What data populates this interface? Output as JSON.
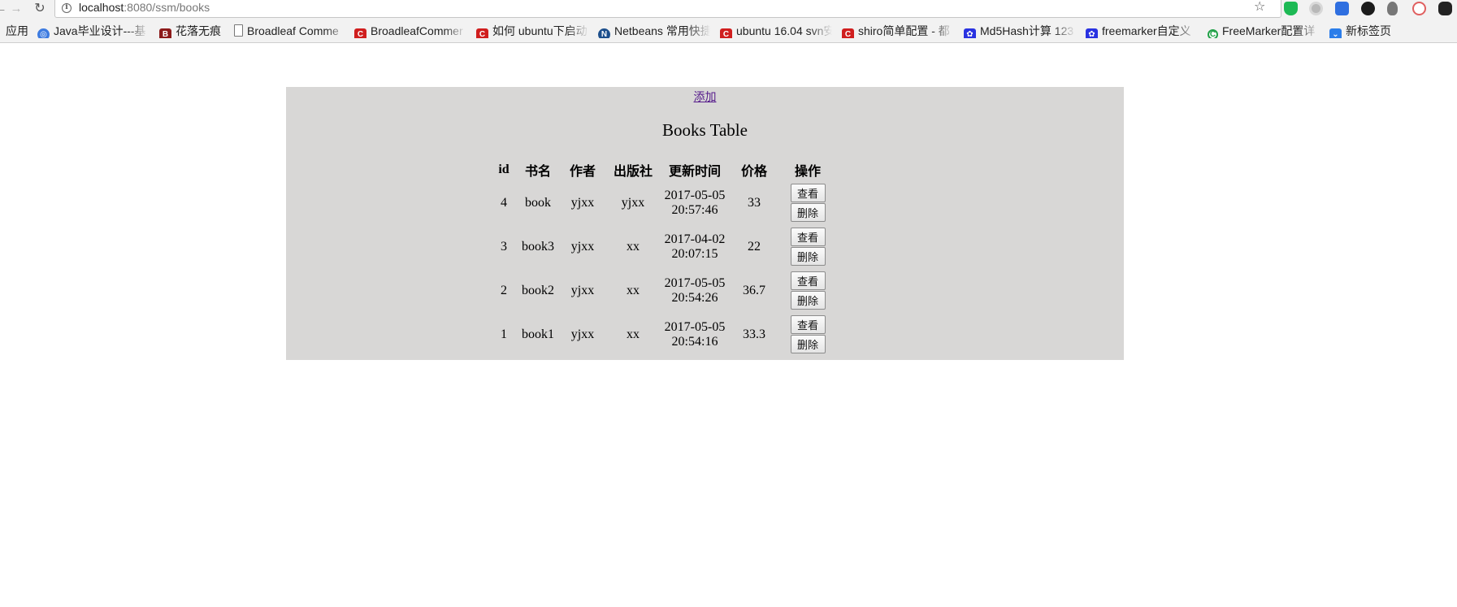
{
  "browser": {
    "url_host": "localhost",
    "url_rest": ":8080/ssm/books",
    "apps_label": "应用",
    "bookmarks": [
      {
        "label": "Java毕业设计---基",
        "icon": "globe-icon"
      },
      {
        "label": "花落无痕",
        "icon": "b-logo-icon"
      },
      {
        "label": "Broadleaf Comme",
        "icon": "page-icon"
      },
      {
        "label": "BroadleafCommer",
        "icon": "csdn-icon"
      },
      {
        "label": "如何 ubuntu下启动",
        "icon": "csdn-icon"
      },
      {
        "label": "Netbeans 常用快捷",
        "icon": "netbeans-icon"
      },
      {
        "label": "ubuntu 16.04 svn安",
        "icon": "csdn-icon"
      },
      {
        "label": "shiro简单配置 - 都",
        "icon": "csdn-icon"
      },
      {
        "label": "Md5Hash计算 123",
        "icon": "baidu-icon"
      },
      {
        "label": "freemarker自定义",
        "icon": "baidu-icon"
      },
      {
        "label": "FreeMarker配置详",
        "icon": "c-green-icon"
      },
      {
        "label": "新标签页",
        "icon": "new-tab-icon"
      }
    ]
  },
  "page": {
    "add_link": "添加",
    "caption": "Books Table",
    "headers": {
      "id": "id",
      "name": "书名",
      "author": "作者",
      "publisher": "出版社",
      "updated": "更新时间",
      "price": "价格",
      "ops": "操作"
    },
    "view_label": "查看",
    "delete_label": "删除",
    "rows": [
      {
        "id": "4",
        "name": "book",
        "author": "yjxx",
        "publisher": "yjxx",
        "date": "2017-05-05",
        "time": "20:57:46",
        "price": "33"
      },
      {
        "id": "3",
        "name": "book3",
        "author": "yjxx",
        "publisher": "xx",
        "date": "2017-04-02",
        "time": "20:07:15",
        "price": "22"
      },
      {
        "id": "2",
        "name": "book2",
        "author": "yjxx",
        "publisher": "xx",
        "date": "2017-05-05",
        "time": "20:54:26",
        "price": "36.7"
      },
      {
        "id": "1",
        "name": "book1",
        "author": "yjxx",
        "publisher": "xx",
        "date": "2017-05-05",
        "time": "20:54:16",
        "price": "33.3"
      }
    ]
  },
  "colors": {
    "panel_bg": "#d8d7d6",
    "link": "#551a8b",
    "chrome_bg": "#f2f2f2"
  }
}
